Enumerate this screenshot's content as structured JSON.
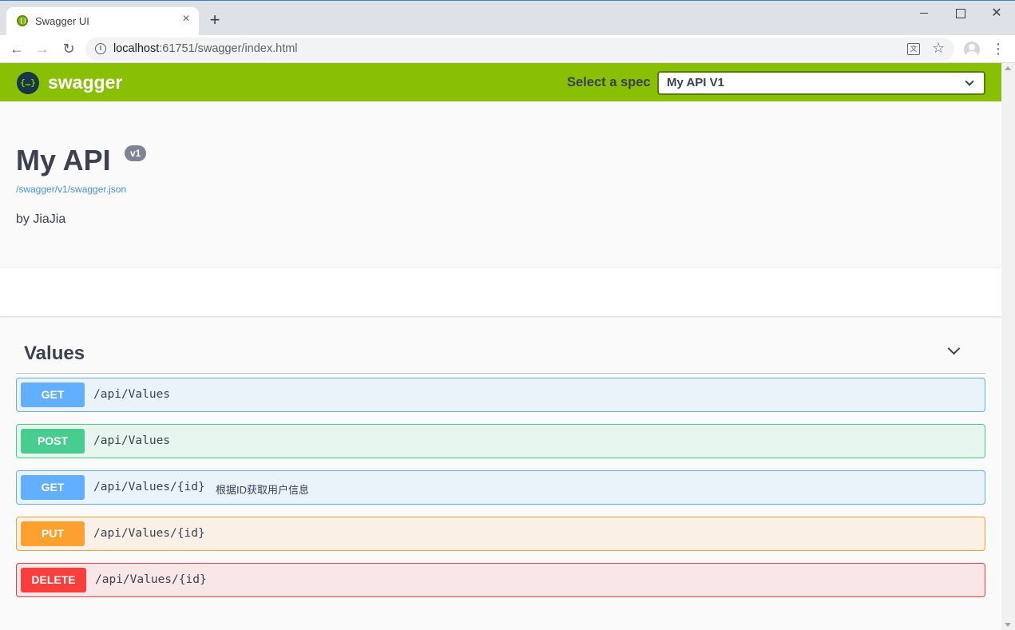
{
  "browser": {
    "tab_title": "Swagger UI",
    "tab_close": "×",
    "new_tab": "+",
    "window_close": "✕",
    "url_host": "localhost",
    "url_rest": ":61751/swagger/index.html",
    "nav_back": "←",
    "nav_forward": "→",
    "nav_reload": "↻",
    "info_icon": "i",
    "translate_icon": "文",
    "star_icon": "☆",
    "menu_icon": "⋮"
  },
  "topbar": {
    "logo_glyph": "{…}",
    "brand": "swagger",
    "spec_label": "Select a spec",
    "spec_value": "My API V1"
  },
  "info": {
    "title": "My API",
    "version": "v1",
    "spec_url": "/swagger/v1/swagger.json",
    "description": "by JiaJia"
  },
  "section": {
    "title": "Values"
  },
  "operations": [
    {
      "method": "GET",
      "path": "/api/Values",
      "summary": ""
    },
    {
      "method": "POST",
      "path": "/api/Values",
      "summary": ""
    },
    {
      "method": "GET",
      "path": "/api/Values/{id}",
      "summary": "根据ID获取用户信息"
    },
    {
      "method": "PUT",
      "path": "/api/Values/{id}",
      "summary": ""
    },
    {
      "method": "DELETE",
      "path": "/api/Values/{id}",
      "summary": ""
    }
  ],
  "colors": {
    "topbar": "#89bf04",
    "get": "#61affe",
    "post": "#49cc90",
    "put": "#fca130",
    "delete": "#f93e3e",
    "text": "#3b4151"
  }
}
